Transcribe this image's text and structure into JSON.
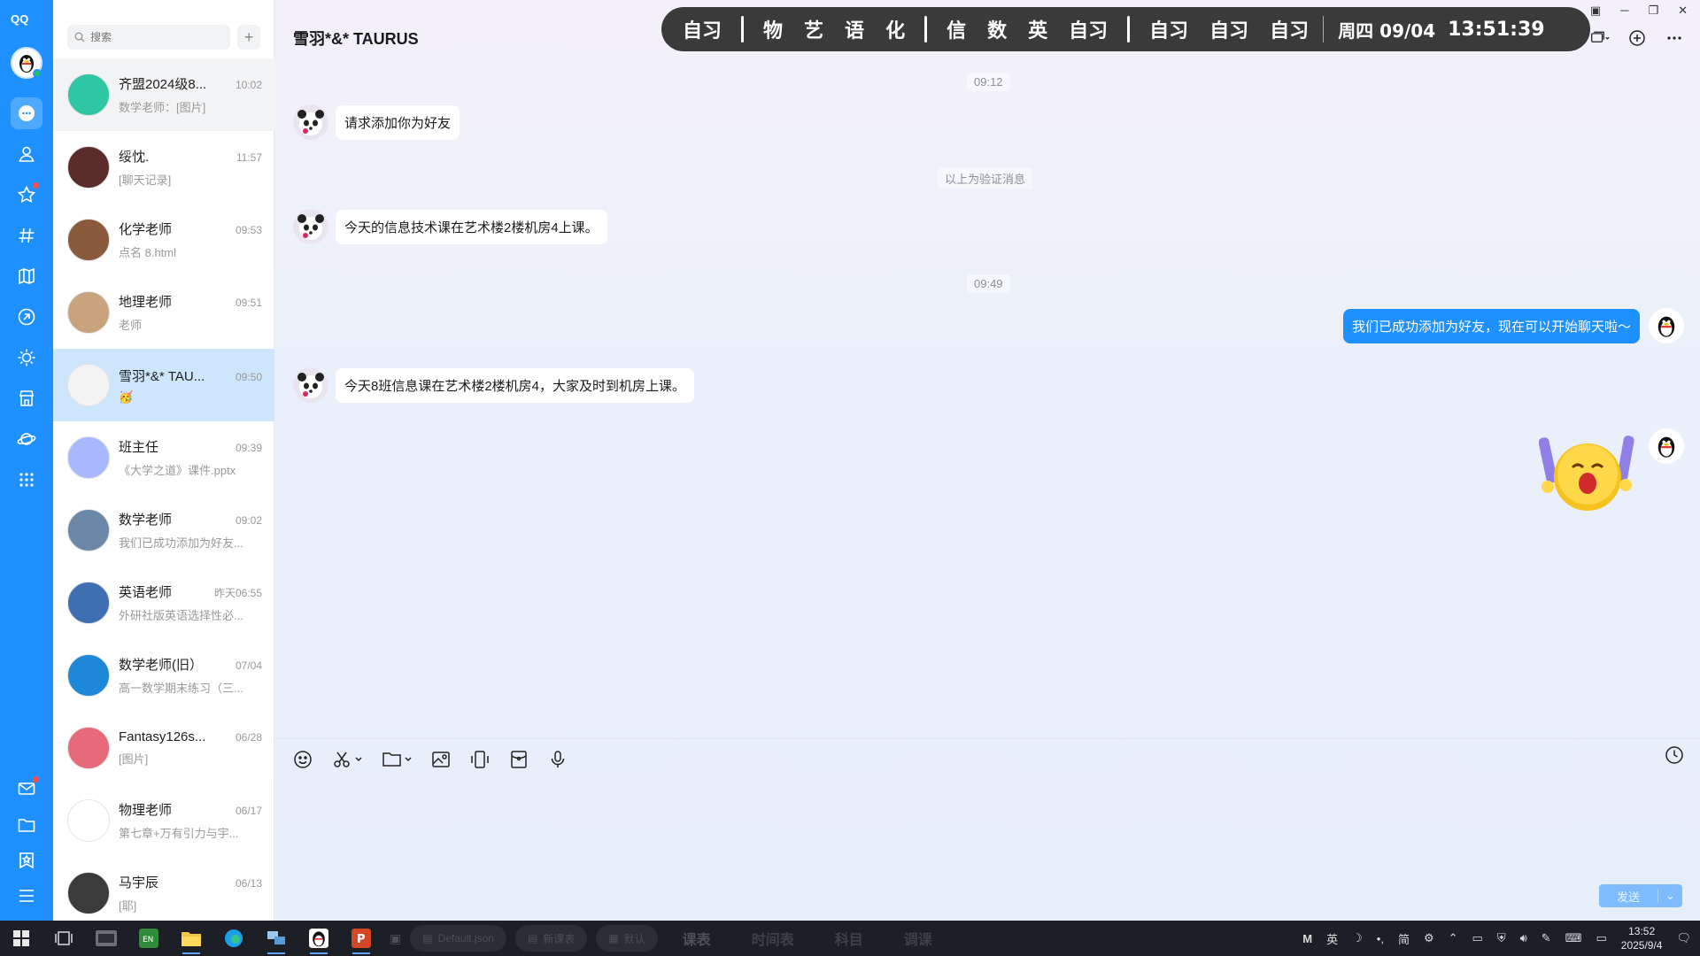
{
  "app": {
    "logo": "QQ"
  },
  "search": {
    "placeholder": "搜索"
  },
  "conversations": [
    {
      "name": "齐盟2024级8...",
      "time": "10:02",
      "preview": "数学老师：[图片]",
      "avatar_color": "#2fc7a3"
    },
    {
      "name": "绥忱.",
      "time": "11:57",
      "preview": "[聊天记录]",
      "avatar_color": "#5a2c2c"
    },
    {
      "name": "化学老师",
      "time": "09:53",
      "preview": "点名 8.html",
      "avatar_color": "#8a5a3c"
    },
    {
      "name": "地理老师",
      "time": "09:51",
      "preview": "老师",
      "avatar_color": "#c9a27e"
    },
    {
      "name": "雪羽*&* TAU...",
      "time": "09:50",
      "preview": "🥳",
      "avatar_color": "#f3f3f3"
    },
    {
      "name": "班主任",
      "time": "09:39",
      "preview": "《大学之道》课件.pptx",
      "avatar_color": "#a7b8ff"
    },
    {
      "name": "数学老师",
      "time": "09:02",
      "preview": "我们已成功添加为好友...",
      "avatar_color": "#6b88a8"
    },
    {
      "name": "英语老师",
      "time": "昨天06:55",
      "preview": "外研社版英语选择性必...",
      "avatar_color": "#3f6fb2"
    },
    {
      "name": "数学老师(旧）",
      "time": "07/04",
      "preview": "高一数学期末练习（三...",
      "avatar_color": "#1e88d8"
    },
    {
      "name": "Fantasy126s...",
      "time": "06/28",
      "preview": "[图片]",
      "avatar_color": "#e66a7a"
    },
    {
      "name": "物理老师",
      "time": "06/17",
      "preview": "第七章+万有引力与宇...",
      "avatar_color": "#ffffff"
    },
    {
      "name": "马宇辰",
      "time": "06/13",
      "preview": "[耶]",
      "avatar_color": "#3b3b3b"
    }
  ],
  "chat": {
    "title": "雪羽*&* TAURUS",
    "stamp1": "09:12",
    "msg1": "请求添加你为好友",
    "verify_note": "以上为验证消息",
    "msg2": "今天的信息技术课在艺术楼2楼机房4上课。",
    "stamp2": "09:49",
    "msg3": "我们已成功添加为好友，现在可以开始聊天啦～",
    "msg4": "今天8班信息课在艺术楼2楼机房4，大家及时到机房上课。",
    "send_label": "发送"
  },
  "schedule": {
    "group1": [
      "自习"
    ],
    "group2": [
      "物",
      "艺",
      "语",
      "化"
    ],
    "group3": [
      "信",
      "数",
      "英",
      "自习"
    ],
    "group4": [
      "自习",
      "自习",
      "自习"
    ],
    "date": "周四 09/04",
    "clock": "13:51:39"
  },
  "taskbar": {
    "pill1": "Default.json",
    "pill2": "新课表",
    "pill3": "默认",
    "tab1": "课表",
    "tab2": "时间表",
    "tab3": "科目",
    "tab4": "调课",
    "ime": "英",
    "ime2": "简",
    "time": "13:52",
    "date": "2025/9/4"
  },
  "colors": {
    "accent": "#1e90ff",
    "selected": "#cde6fb",
    "schedule_bg": "#3a3a3a"
  }
}
